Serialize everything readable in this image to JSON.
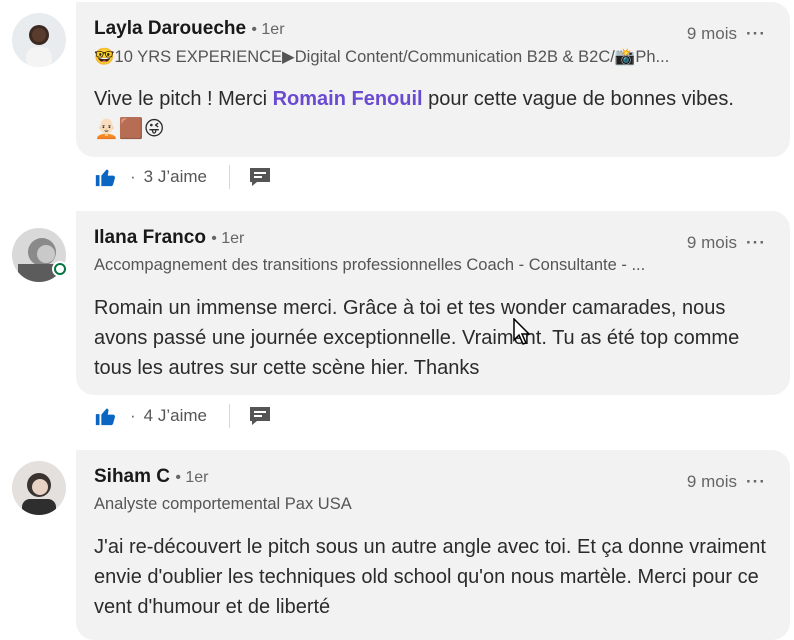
{
  "comments": [
    {
      "name": "Layla Daroueche",
      "degree": "• 1er",
      "headline": "🤓10 YRS EXPERIENCE▶Digital Content/Communication B2B & B2C/📸Ph...",
      "time": "9 mois",
      "more": "···",
      "text_before": "Vive le pitch ! Merci ",
      "mention": "Romain Fenouil",
      "text_after": " pour cette vague de bonnes vibes.",
      "emojis": "🧑🏻‍🦲🟫😜",
      "likes": "3 J’aime",
      "like_dot": "·",
      "avatar_color": "#cfd6dd"
    },
    {
      "name": "Ilana Franco",
      "degree": "• 1er",
      "headline": "Accompagnement des transitions professionnelles Coach - Consultante - ...",
      "time": "9 mois",
      "more": "···",
      "text": "Romain un immense merci. Grâce à toi et tes wonder camarades, nous avons passé une journée exceptionnelle. Vraiment. Tu as été top comme tous les autres sur cette scène hier. Thanks",
      "likes": "4 J’aime",
      "like_dot": "·",
      "online": true,
      "avatar_color": "#9a9a9a"
    },
    {
      "name": "Siham C",
      "degree": "• 1er",
      "headline": "Analyste comportemental Pax USA",
      "time": "9 mois",
      "more": "···",
      "text": "J'ai re-découvert le pitch sous un autre angle avec toi. Et ça donne vraiment envie d'oublier les techniques old school qu'on nous martèle. Merci pour ce vent d'humour et de liberté",
      "avatar_color": "#c8c2be"
    }
  ],
  "colors": {
    "like_blue": "#0a66c2",
    "mention": "#6a4ad1",
    "online_green": "#057642"
  }
}
